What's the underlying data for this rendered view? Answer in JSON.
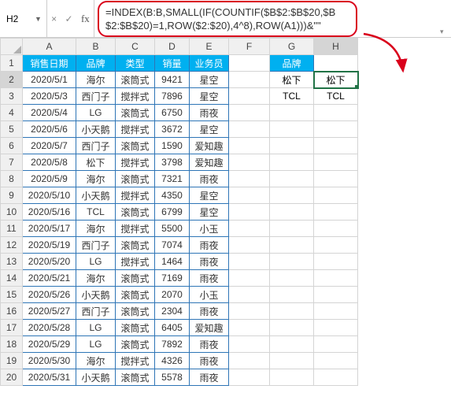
{
  "nameBox": {
    "value": "H2"
  },
  "fx": {
    "cross": "×",
    "check": "✓",
    "label": "fx"
  },
  "formula": "=INDEX(B:B,SMALL(IF(COUNTIF($B$2:$B$20,$B$2:$B$20)=1,ROW($2:$20),4^8),ROW(A1)))&\"\"",
  "columns": [
    "A",
    "B",
    "C",
    "D",
    "E",
    "F",
    "G",
    "H"
  ],
  "headers": {
    "A": "销售日期",
    "B": "品牌",
    "C": "类型",
    "D": "销量",
    "E": "业务员",
    "G": "品牌"
  },
  "rows": [
    {
      "n": 1,
      "A": "",
      "B": "",
      "C": "",
      "D": "",
      "E": "",
      "G": "",
      "H": ""
    },
    {
      "n": 2,
      "A": "2020/5/1",
      "B": "海尔",
      "C": "滚筒式",
      "D": "9421",
      "E": "星空",
      "G": "松下",
      "H": "松下"
    },
    {
      "n": 3,
      "A": "2020/5/3",
      "B": "西门子",
      "C": "搅拌式",
      "D": "7896",
      "E": "星空",
      "G": "TCL",
      "H": "TCL"
    },
    {
      "n": 4,
      "A": "2020/5/4",
      "B": "LG",
      "C": "滚筒式",
      "D": "6750",
      "E": "雨夜",
      "G": "",
      "H": ""
    },
    {
      "n": 5,
      "A": "2020/5/6",
      "B": "小天鹅",
      "C": "搅拌式",
      "D": "3672",
      "E": "星空",
      "G": "",
      "H": ""
    },
    {
      "n": 6,
      "A": "2020/5/7",
      "B": "西门子",
      "C": "滚筒式",
      "D": "1590",
      "E": "爱知趣",
      "G": "",
      "H": ""
    },
    {
      "n": 7,
      "A": "2020/5/8",
      "B": "松下",
      "C": "搅拌式",
      "D": "3798",
      "E": "爱知趣",
      "G": "",
      "H": ""
    },
    {
      "n": 8,
      "A": "2020/5/9",
      "B": "海尔",
      "C": "滚筒式",
      "D": "7321",
      "E": "雨夜",
      "G": "",
      "H": ""
    },
    {
      "n": 9,
      "A": "2020/5/10",
      "B": "小天鹅",
      "C": "搅拌式",
      "D": "4350",
      "E": "星空",
      "G": "",
      "H": ""
    },
    {
      "n": 10,
      "A": "2020/5/16",
      "B": "TCL",
      "C": "滚筒式",
      "D": "6799",
      "E": "星空",
      "G": "",
      "H": ""
    },
    {
      "n": 11,
      "A": "2020/5/17",
      "B": "海尔",
      "C": "搅拌式",
      "D": "5500",
      "E": "小玉",
      "G": "",
      "H": ""
    },
    {
      "n": 12,
      "A": "2020/5/19",
      "B": "西门子",
      "C": "滚筒式",
      "D": "7074",
      "E": "雨夜",
      "G": "",
      "H": ""
    },
    {
      "n": 13,
      "A": "2020/5/20",
      "B": "LG",
      "C": "搅拌式",
      "D": "1464",
      "E": "雨夜",
      "G": "",
      "H": ""
    },
    {
      "n": 14,
      "A": "2020/5/21",
      "B": "海尔",
      "C": "滚筒式",
      "D": "7169",
      "E": "雨夜",
      "G": "",
      "H": ""
    },
    {
      "n": 15,
      "A": "2020/5/26",
      "B": "小天鹅",
      "C": "滚筒式",
      "D": "2070",
      "E": "小玉",
      "G": "",
      "H": ""
    },
    {
      "n": 16,
      "A": "2020/5/27",
      "B": "西门子",
      "C": "滚筒式",
      "D": "2304",
      "E": "雨夜",
      "G": "",
      "H": ""
    },
    {
      "n": 17,
      "A": "2020/5/28",
      "B": "LG",
      "C": "滚筒式",
      "D": "6405",
      "E": "爱知趣",
      "G": "",
      "H": ""
    },
    {
      "n": 18,
      "A": "2020/5/29",
      "B": "LG",
      "C": "滚筒式",
      "D": "7892",
      "E": "雨夜",
      "G": "",
      "H": ""
    },
    {
      "n": 19,
      "A": "2020/5/30",
      "B": "海尔",
      "C": "搅拌式",
      "D": "4326",
      "E": "雨夜",
      "G": "",
      "H": ""
    },
    {
      "n": 20,
      "A": "2020/5/31",
      "B": "小天鹅",
      "C": "滚筒式",
      "D": "5578",
      "E": "雨夜",
      "G": "",
      "H": ""
    }
  ],
  "activeCell": "H2",
  "chart_data": {
    "type": "table",
    "title": "销售数据",
    "columns": [
      "销售日期",
      "品牌",
      "类型",
      "销量",
      "业务员"
    ],
    "data": [
      [
        "2020/5/1",
        "海尔",
        "滚筒式",
        9421,
        "星空"
      ],
      [
        "2020/5/3",
        "西门子",
        "搅拌式",
        7896,
        "星空"
      ],
      [
        "2020/5/4",
        "LG",
        "滚筒式",
        6750,
        "雨夜"
      ],
      [
        "2020/5/6",
        "小天鹅",
        "搅拌式",
        3672,
        "星空"
      ],
      [
        "2020/5/7",
        "西门子",
        "滚筒式",
        1590,
        "爱知趣"
      ],
      [
        "2020/5/8",
        "松下",
        "搅拌式",
        3798,
        "爱知趣"
      ],
      [
        "2020/5/9",
        "海尔",
        "滚筒式",
        7321,
        "雨夜"
      ],
      [
        "2020/5/10",
        "小天鹅",
        "搅拌式",
        4350,
        "星空"
      ],
      [
        "2020/5/16",
        "TCL",
        "滚筒式",
        6799,
        "星空"
      ],
      [
        "2020/5/17",
        "海尔",
        "搅拌式",
        5500,
        "小玉"
      ],
      [
        "2020/5/19",
        "西门子",
        "滚筒式",
        7074,
        "雨夜"
      ],
      [
        "2020/5/20",
        "LG",
        "搅拌式",
        1464,
        "雨夜"
      ],
      [
        "2020/5/21",
        "海尔",
        "滚筒式",
        7169,
        "雨夜"
      ],
      [
        "2020/5/26",
        "小天鹅",
        "滚筒式",
        2070,
        "小玉"
      ],
      [
        "2020/5/27",
        "西门子",
        "滚筒式",
        2304,
        "雨夜"
      ],
      [
        "2020/5/28",
        "LG",
        "滚筒式",
        6405,
        "爱知趣"
      ],
      [
        "2020/5/29",
        "LG",
        "滚筒式",
        7892,
        "雨夜"
      ],
      [
        "2020/5/30",
        "海尔",
        "搅拌式",
        4326,
        "雨夜"
      ],
      [
        "2020/5/31",
        "小天鹅",
        "滚筒式",
        5578,
        "雨夜"
      ]
    ],
    "unique_brands": [
      "松下",
      "TCL"
    ]
  }
}
